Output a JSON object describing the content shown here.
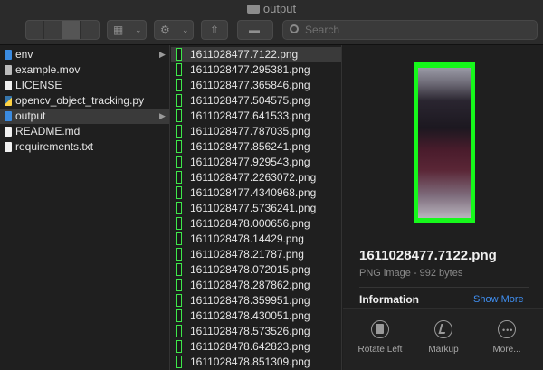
{
  "window": {
    "title": "output"
  },
  "toolbar": {
    "search_placeholder": "Search"
  },
  "column1": {
    "items": [
      {
        "name": "env",
        "kind": "folder",
        "has_children": true,
        "selected": false
      },
      {
        "name": "example.mov",
        "kind": "movie",
        "has_children": false,
        "selected": false
      },
      {
        "name": "LICENSE",
        "kind": "doc",
        "has_children": false,
        "selected": false
      },
      {
        "name": "opencv_object_tracking.py",
        "kind": "python",
        "has_children": false,
        "selected": false
      },
      {
        "name": "output",
        "kind": "folder",
        "has_children": true,
        "selected": true
      },
      {
        "name": "README.md",
        "kind": "doc",
        "has_children": false,
        "selected": false
      },
      {
        "name": "requirements.txt",
        "kind": "doc",
        "has_children": false,
        "selected": false
      }
    ]
  },
  "column2": {
    "items": [
      {
        "name": "1611028477.7122.png",
        "selected": true
      },
      {
        "name": "1611028477.295381.png",
        "selected": false
      },
      {
        "name": "1611028477.365846.png",
        "selected": false
      },
      {
        "name": "1611028477.504575.png",
        "selected": false
      },
      {
        "name": "1611028477.641533.png",
        "selected": false
      },
      {
        "name": "1611028477.787035.png",
        "selected": false
      },
      {
        "name": "1611028477.856241.png",
        "selected": false
      },
      {
        "name": "1611028477.929543.png",
        "selected": false
      },
      {
        "name": "1611028477.2263072.png",
        "selected": false
      },
      {
        "name": "1611028477.4340968.png",
        "selected": false
      },
      {
        "name": "1611028477.5736241.png",
        "selected": false
      },
      {
        "name": "1611028478.000656.png",
        "selected": false
      },
      {
        "name": "1611028478.14429.png",
        "selected": false
      },
      {
        "name": "1611028478.21787.png",
        "selected": false
      },
      {
        "name": "1611028478.072015.png",
        "selected": false
      },
      {
        "name": "1611028478.287862.png",
        "selected": false
      },
      {
        "name": "1611028478.359951.png",
        "selected": false
      },
      {
        "name": "1611028478.430051.png",
        "selected": false
      },
      {
        "name": "1611028478.573526.png",
        "selected": false
      },
      {
        "name": "1611028478.642823.png",
        "selected": false
      },
      {
        "name": "1611028478.851309.png",
        "selected": false
      }
    ]
  },
  "preview": {
    "filename": "1611028477.7122.png",
    "subtitle": "PNG image - 992 bytes",
    "info_heading": "Information",
    "show_more": "Show More",
    "frame_color": "#16f81b",
    "actions": {
      "rotate_label": "Rotate Left",
      "markup_label": "Markup",
      "more_label": "More..."
    }
  },
  "colors": {
    "accent": "#3f8ef0",
    "folder": "#3b8be0",
    "thumb_outline": "#3ee84a"
  }
}
